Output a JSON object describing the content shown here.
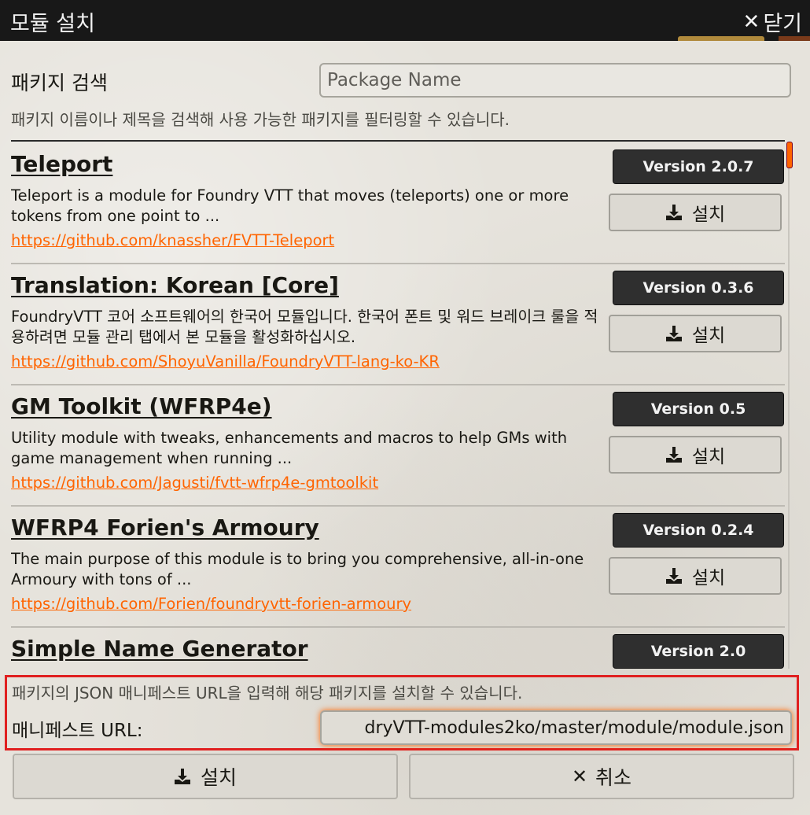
{
  "window": {
    "title": "모듈 설치",
    "close_label": "닫기"
  },
  "search": {
    "label": "패키지 검색",
    "placeholder": "Package Name",
    "hint": "패키지 이름이나 제목을 검색해 사용 가능한 패키지를 필터링할 수 있습니다."
  },
  "packages": [
    {
      "title": "Teleport",
      "version": "Version 2.0.7",
      "description": "Teleport is a module for Foundry VTT that moves (teleports) one or more tokens from one point to ...",
      "url": "https://github.com/knassher/FVTT-Teleport",
      "install_label": "설치"
    },
    {
      "title": "Translation: Korean [Core]",
      "version": "Version 0.3.6",
      "description": "FoundryVTT 코어 소프트웨어의 한국어 모듈입니다. 한국어 폰트 및 워드 브레이크 룰을 적용하려면 모듈 관리 탭에서 본 모듈을 활성화하십시오.",
      "url": "https://github.com/ShoyuVanilla/FoundryVTT-lang-ko-KR",
      "install_label": "설치"
    },
    {
      "title": "GM Toolkit (WFRP4e)",
      "version": "Version 0.5",
      "description": "Utility module with tweaks, enhancements and macros to help GMs with game management when running ...",
      "url": "https://github.com/Jagusti/fvtt-wfrp4e-gmtoolkit",
      "install_label": "설치"
    },
    {
      "title": "WFRP4 Forien's Armoury",
      "version": "Version 0.2.4",
      "description": "The main purpose of this module is to bring you comprehensive, all-in-one Armoury with tons of ...",
      "url": "https://github.com/Forien/foundryvtt-forien-armoury",
      "install_label": "설치"
    },
    {
      "title": "Simple Name Generator",
      "version": "Version 2.0",
      "description": "",
      "url": "",
      "install_label": "설치"
    }
  ],
  "manifest": {
    "hint": "패키지의 JSON 매니페스트 URL을 입력해 해당 패키지를 설치할 수 있습니다.",
    "label": "매니페스트 URL:",
    "value": "dryVTT-modules2ko/master/module/module.json"
  },
  "footer": {
    "install_label": "설치",
    "cancel_label": "취소"
  },
  "colors": {
    "accent": "#ff6400",
    "highlight_border": "#e02020",
    "titlebar": "#181818",
    "version_badge": "#2f2f2f"
  }
}
